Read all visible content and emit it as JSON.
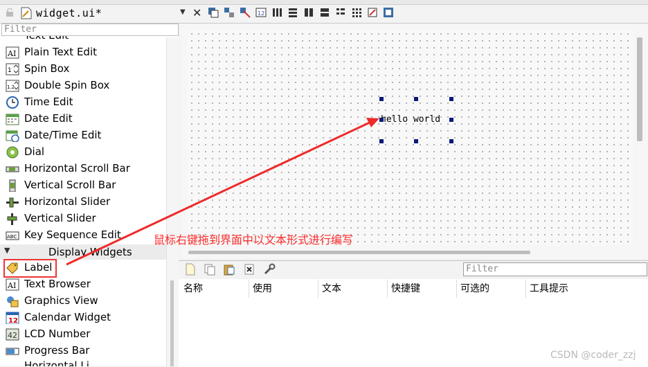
{
  "tab": {
    "title": "widget.ui*"
  },
  "widget_box": {
    "filter_placeholder": "Filter",
    "partial_top_item": "Text Edit",
    "items": [
      {
        "label": "Plain Text Edit",
        "icon": "plain-text-edit-icon"
      },
      {
        "label": "Spin Box",
        "icon": "spin-box-icon"
      },
      {
        "label": "Double Spin Box",
        "icon": "double-spin-box-icon"
      },
      {
        "label": "Time Edit",
        "icon": "clock-icon"
      },
      {
        "label": "Date Edit",
        "icon": "calendar-icon"
      },
      {
        "label": "Date/Time Edit",
        "icon": "datetime-icon"
      },
      {
        "label": "Dial",
        "icon": "dial-icon"
      },
      {
        "label": "Horizontal Scroll Bar",
        "icon": "horizontal-scrollbar-icon"
      },
      {
        "label": "Vertical Scroll Bar",
        "icon": "vertical-scrollbar-icon"
      },
      {
        "label": "Horizontal Slider",
        "icon": "horizontal-slider-icon"
      },
      {
        "label": "Vertical Slider",
        "icon": "vertical-slider-icon"
      },
      {
        "label": "Key Sequence Edit",
        "icon": "key-sequence-icon"
      }
    ],
    "category": "Display Widgets",
    "display_items": [
      {
        "label": "Label",
        "icon": "label-tag-icon"
      },
      {
        "label": "Text Browser",
        "icon": "text-browser-icon"
      },
      {
        "label": "Graphics View",
        "icon": "graphics-view-icon"
      },
      {
        "label": "Calendar Widget",
        "icon": "calendar-widget-icon"
      },
      {
        "label": "LCD Number",
        "icon": "lcd-number-icon"
      },
      {
        "label": "Progress Bar",
        "icon": "progress-bar-icon"
      }
    ],
    "partial_bottom_item": "Horizontal Li"
  },
  "form": {
    "label_text": "hello world"
  },
  "annotation": {
    "text": "鼠标右键拖到界面中以文本形式进行编写",
    "color": "#ff2b2b"
  },
  "action_editor": {
    "filter_placeholder": "Filter",
    "columns": [
      "名称",
      "使用",
      "文本",
      "快捷键",
      "可选的",
      "工具提示"
    ]
  },
  "watermark": "CSDN @coder_zzj"
}
